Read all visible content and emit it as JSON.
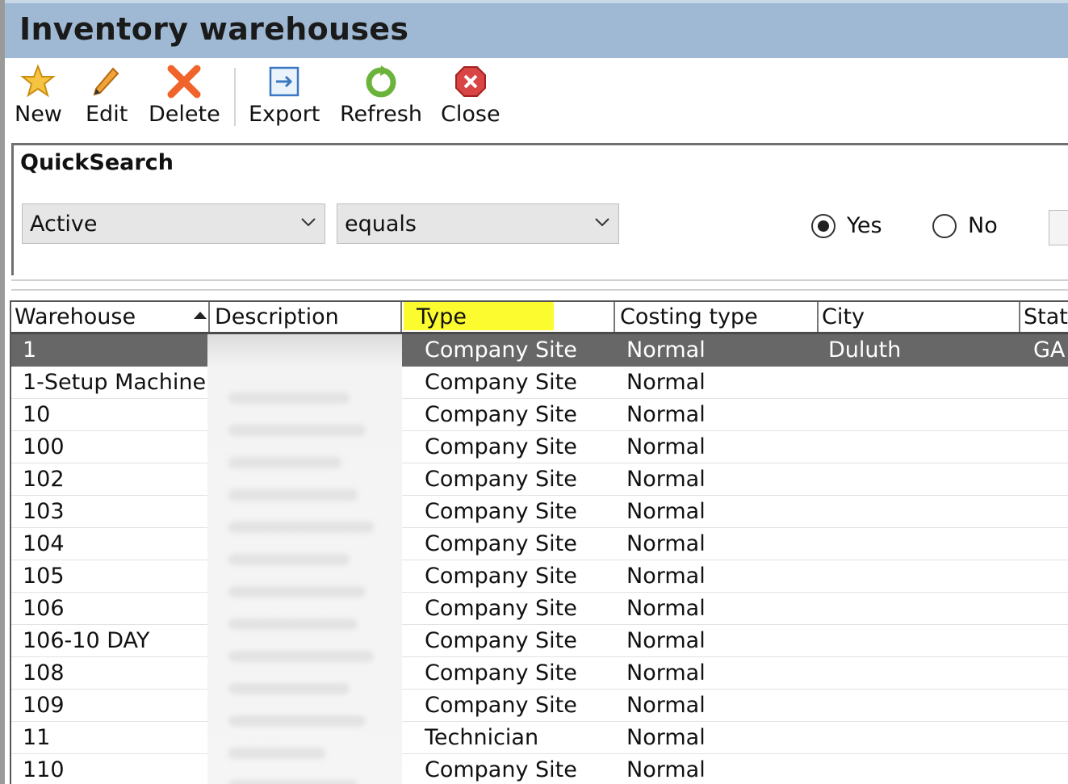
{
  "window": {
    "title": "Inventory warehouses"
  },
  "toolbar": {
    "buttons": [
      {
        "label": "New",
        "icon": "star-icon"
      },
      {
        "label": "Edit",
        "icon": "pencil-icon"
      },
      {
        "label": "Delete",
        "icon": "delete-x-icon"
      },
      {
        "label": "Export",
        "icon": "export-icon"
      },
      {
        "label": "Refresh",
        "icon": "refresh-icon"
      },
      {
        "label": "Close",
        "icon": "close-icon"
      }
    ]
  },
  "quicksearch": {
    "title": "QuickSearch",
    "field": "Active",
    "operator": "equals",
    "options": {
      "yes": "Yes",
      "no": "No"
    },
    "selected": "Yes"
  },
  "grid": {
    "columns": [
      "Warehouse",
      "Description",
      "Type",
      "Costing type",
      "City",
      "State"
    ],
    "sorted_column": "Warehouse",
    "highlighted_column": "Type",
    "rows": [
      {
        "warehouse": "1",
        "type": "Company Site",
        "costing": "Normal",
        "city": "Duluth",
        "state": "GA"
      },
      {
        "warehouse": "1-Setup Machine",
        "type": "Company Site",
        "costing": "Normal",
        "city": "",
        "state": ""
      },
      {
        "warehouse": "10",
        "type": "Company Site",
        "costing": "Normal",
        "city": "",
        "state": ""
      },
      {
        "warehouse": "100",
        "type": "Company Site",
        "costing": "Normal",
        "city": "",
        "state": ""
      },
      {
        "warehouse": "102",
        "type": "Company Site",
        "costing": "Normal",
        "city": "",
        "state": ""
      },
      {
        "warehouse": "103",
        "type": "Company Site",
        "costing": "Normal",
        "city": "",
        "state": ""
      },
      {
        "warehouse": "104",
        "type": "Company Site",
        "costing": "Normal",
        "city": "",
        "state": ""
      },
      {
        "warehouse": "105",
        "type": "Company Site",
        "costing": "Normal",
        "city": "",
        "state": ""
      },
      {
        "warehouse": "106",
        "type": "Company Site",
        "costing": "Normal",
        "city": "",
        "state": ""
      },
      {
        "warehouse": "106-10 DAY",
        "type": "Company Site",
        "costing": "Normal",
        "city": "",
        "state": ""
      },
      {
        "warehouse": "108",
        "type": "Company Site",
        "costing": "Normal",
        "city": "",
        "state": ""
      },
      {
        "warehouse": "109",
        "type": "Company Site",
        "costing": "Normal",
        "city": "",
        "state": ""
      },
      {
        "warehouse": "11",
        "type": "Technician",
        "costing": "Normal",
        "city": "",
        "state": ""
      },
      {
        "warehouse": "110",
        "type": "Company Site",
        "costing": "Normal",
        "city": "",
        "state": ""
      }
    ]
  },
  "colors": {
    "titlebar": "#9fb9d4",
    "selected_row": "#676767",
    "highlight": "#fbfb2f"
  }
}
